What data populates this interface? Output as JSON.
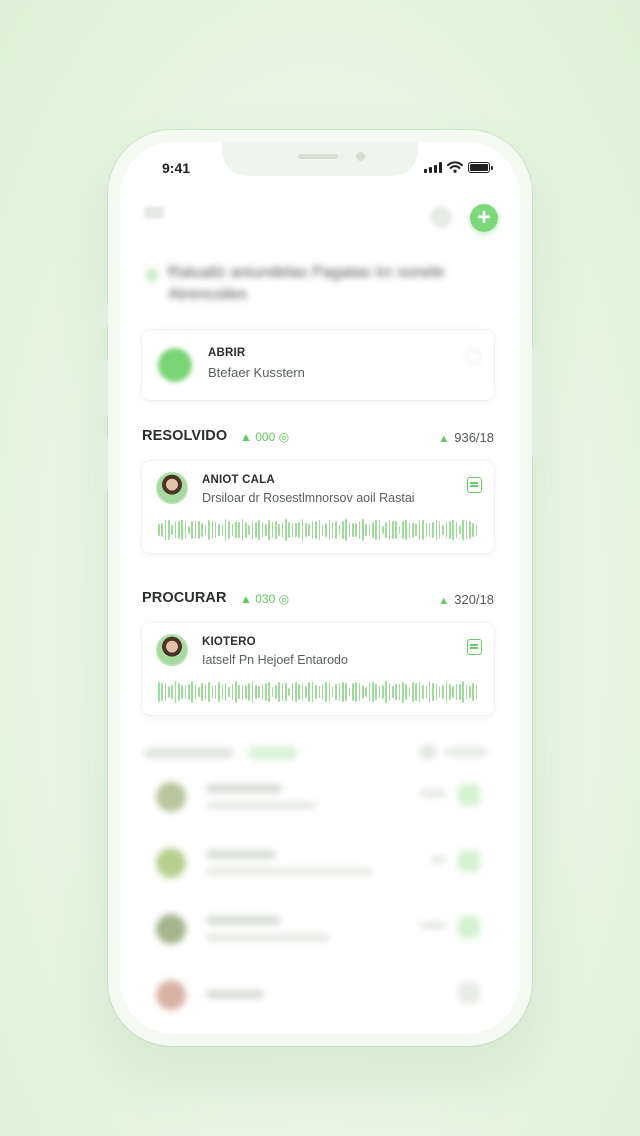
{
  "status_bar": {
    "time": "9:41"
  },
  "header": {
    "menu_icon": "menu-icon",
    "add_icon": "plus-icon",
    "add_label": "+",
    "headline": "Ratualiz aniundelas Pagatas Icr sonele Atrencoiles"
  },
  "open_card": {
    "title": "ABRIR",
    "subtitle": "Btefaer Kusstern"
  },
  "sections": [
    {
      "title": "RESOLVIDO",
      "meta": "000",
      "meta_icon": "thumbs-up-icon",
      "right_value": "936/18",
      "item": {
        "title": "ANIOT CALA",
        "subtitle": "Drsiloar dr Rosestlmnorsov aoil Rastai"
      }
    },
    {
      "title": "PROCURAR",
      "meta": "030",
      "meta_icon": "thumbs-up-icon",
      "right_value": "320/18",
      "item": {
        "title": "KIOTERO",
        "subtitle": "Iatself Pn Hejoef Entarodo"
      }
    }
  ],
  "colors": {
    "accent": "#7cd97a",
    "background": "#e6f5e1",
    "wave": "#9fdc9b"
  }
}
